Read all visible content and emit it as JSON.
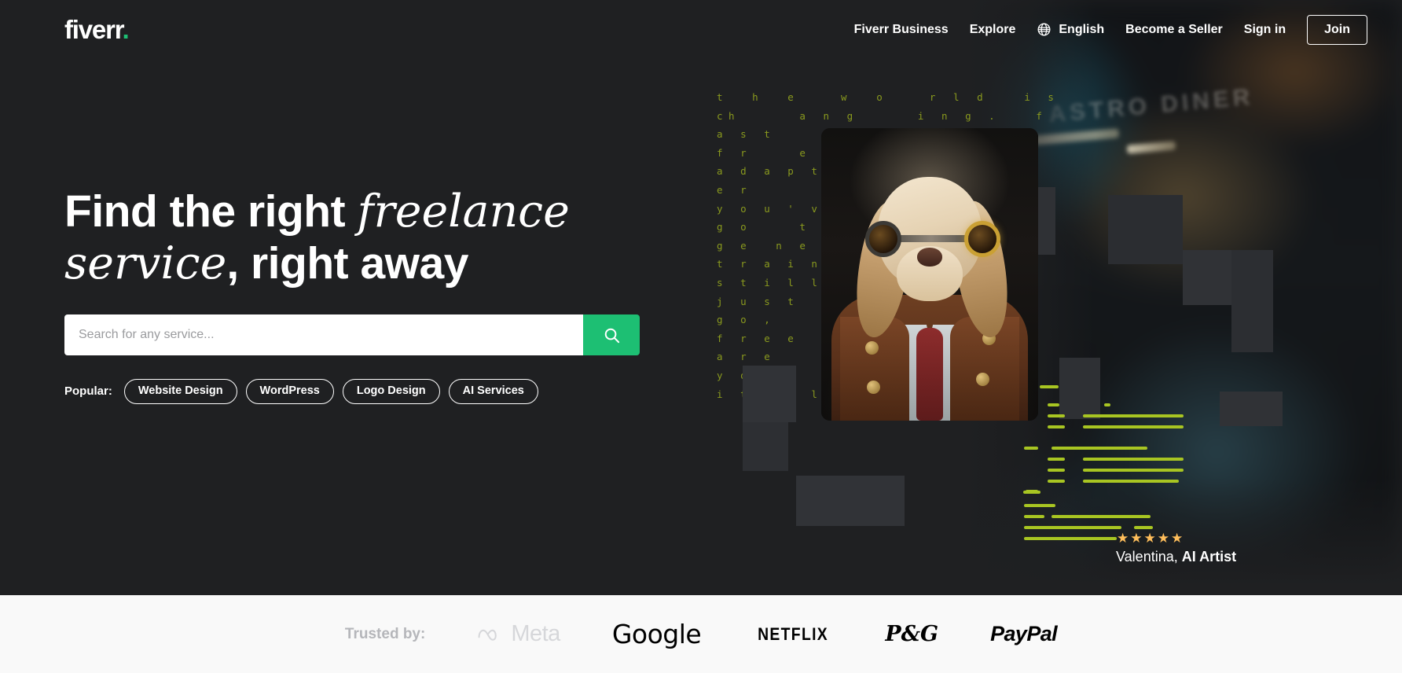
{
  "nav": {
    "logo_text": "fiverr",
    "logo_dot": ".",
    "links": [
      {
        "label": "Fiverr Business",
        "name": "nav-fiverr-business"
      },
      {
        "label": "Explore",
        "name": "nav-explore"
      }
    ],
    "language": "English",
    "language_icon": "globe-icon",
    "become_seller": "Become a Seller",
    "sign_in": "Sign in",
    "join": "Join"
  },
  "hero": {
    "headline_part1": "Find the right ",
    "headline_italic1": "freelance",
    "headline_italic2": "service",
    "headline_part2": ", right away",
    "search": {
      "placeholder": "Search for any service...",
      "value": "",
      "button_icon": "search-icon"
    },
    "popular": {
      "label": "Popular:",
      "tags": [
        "Website Design",
        "WordPress",
        "Logo Design",
        "AI Services"
      ]
    },
    "ascii_art": "t     h     e        w     o        r   l   d       i   s\nc h           a   n   g           i   n   g   .       f\na   s   t\nf   r         e   e\na   d   a   p   t\ne   r\ny   o   u   '   v   e\ng   o         t   t\ng   e     n   e   w\nt   r   a   i   n\ns   t   i   l   l\nj   u   s   t       k\ng   o   ,\nf   r   e   e\na   r   e\ny   o               n\ni   t           l   :",
    "background_sign": "ASTRO DINER",
    "artist": {
      "stars": "★★★★★",
      "star_count": 5,
      "name": "Valentina,",
      "role": "AI Artist"
    }
  },
  "trusted": {
    "label": "Trusted by:",
    "brands": [
      {
        "name": "Meta",
        "icon": "meta-infinity-icon"
      },
      {
        "name": "Google"
      },
      {
        "name": "NETFLIX"
      },
      {
        "name": "P&G"
      },
      {
        "name": "PayPal"
      }
    ]
  },
  "colors": {
    "background": "#1f2022",
    "accent_green": "#1dbf73",
    "ascii_green": "#8a9a1e",
    "line_green": "#a8c522",
    "star_gold": "#ffbe5b",
    "footer_bg": "#f9f9f9"
  }
}
